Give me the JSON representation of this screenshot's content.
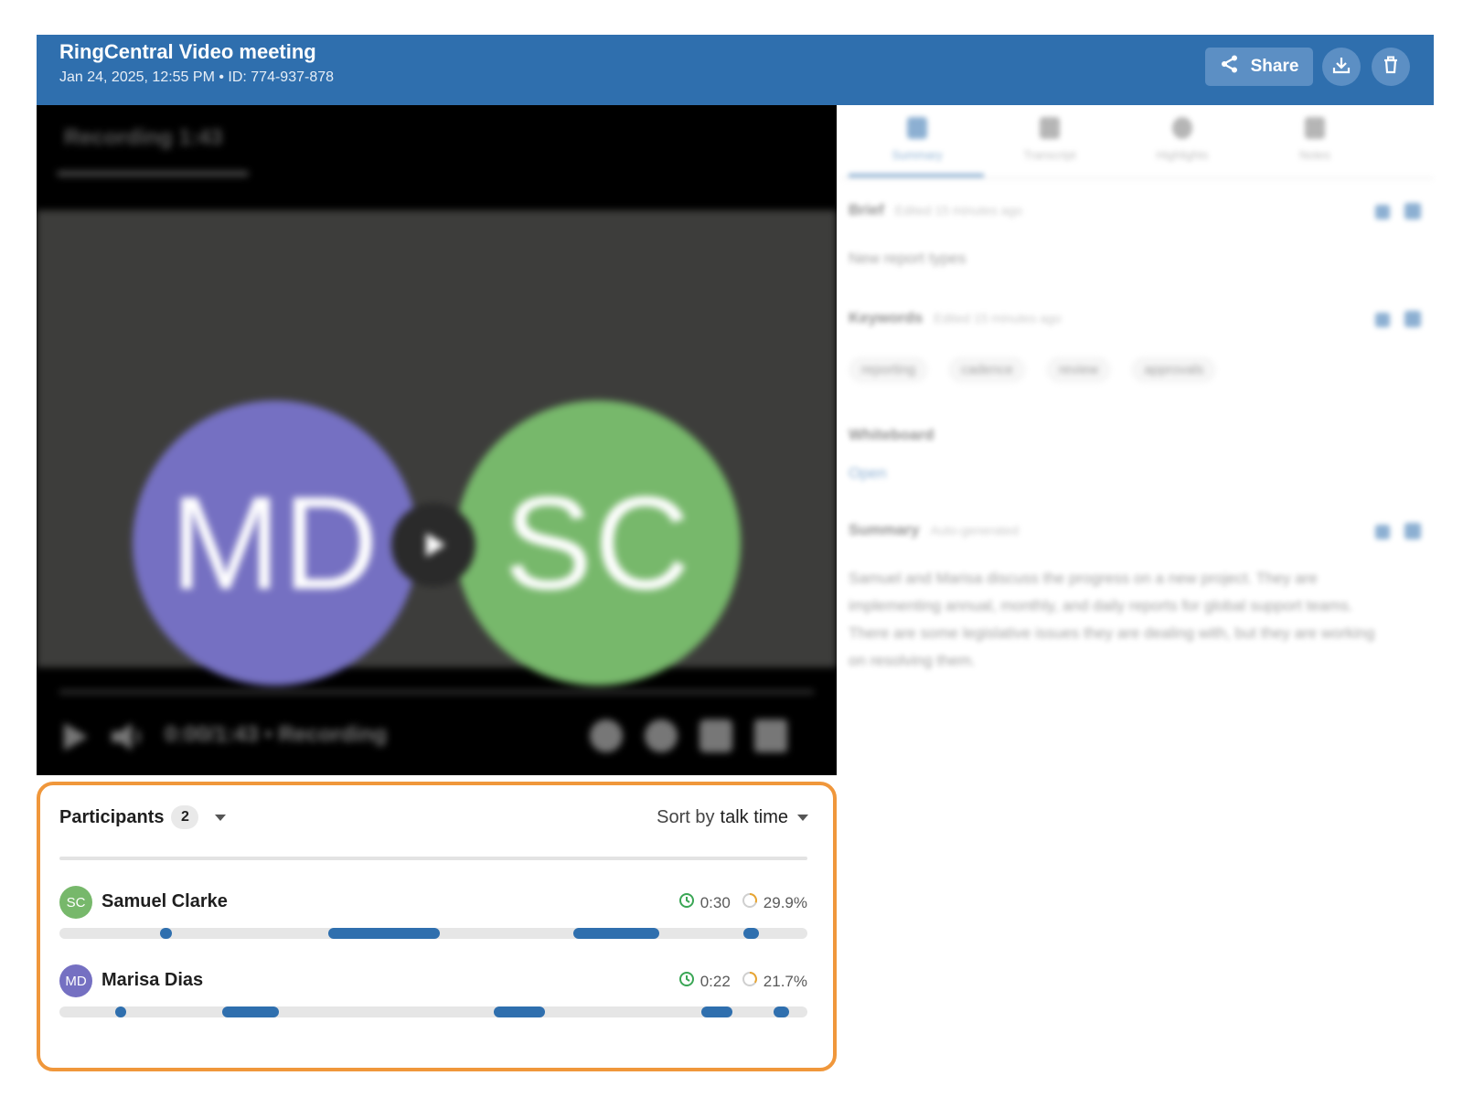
{
  "header": {
    "title": "RingCentral Video meeting",
    "subtitle": "Jan 24, 2025, 12:55 PM • ID: 774-937-878",
    "share_label": "Share",
    "accent": "#2f6fae"
  },
  "video": {
    "top_label": "Recording 1:43",
    "controls_text": "0:00/1:43 • Recording",
    "avatars": [
      {
        "initials": "MD",
        "color": "#7570c2"
      },
      {
        "initials": "SC",
        "color": "#77b86b"
      }
    ]
  },
  "participants": {
    "title": "Participants",
    "count": "2",
    "sort_prefix": "Sort by",
    "sort_value": "talk time",
    "highlight_color": "#f0973b",
    "items": [
      {
        "initials": "SC",
        "name": "Samuel Clarke",
        "talk_time": "0:30",
        "talk_percent": "29.9%",
        "avatar_color": "#77b86b",
        "segments": [
          [
            0.135,
            0.015
          ],
          [
            0.36,
            0.148
          ],
          [
            0.687,
            0.115
          ],
          [
            0.915,
            0.02
          ]
        ]
      },
      {
        "initials": "MD",
        "name": "Marisa Dias",
        "talk_time": "0:22",
        "talk_percent": "21.7%",
        "avatar_color": "#7570c2",
        "segments": [
          [
            0.075,
            0.01
          ],
          [
            0.217,
            0.077
          ],
          [
            0.581,
            0.068
          ],
          [
            0.858,
            0.042
          ],
          [
            0.955,
            0.02
          ]
        ]
      }
    ]
  },
  "right_panel": {
    "tabs": [
      "Summary",
      "Transcript",
      "Highlights",
      "Notes"
    ],
    "active_tab": "Summary",
    "brief": {
      "title": "Brief",
      "meta": "Edited 15 minutes ago",
      "text": "New report types"
    },
    "keywords": {
      "title": "Keywords",
      "meta": "Edited 15 minutes ago",
      "chips": [
        "reporting",
        "cadence",
        "review",
        "approvals"
      ]
    },
    "whiteboard": {
      "title": "Whiteboard",
      "link": "Open"
    },
    "summary": {
      "title": "Summary",
      "meta": "Auto-generated",
      "text": "Samuel and Marisa discuss the progress on a new project. They are implementing annual, monthly, and daily reports for global support teams. There are some legislative issues they are dealing with, but they are working on resolving them."
    }
  }
}
